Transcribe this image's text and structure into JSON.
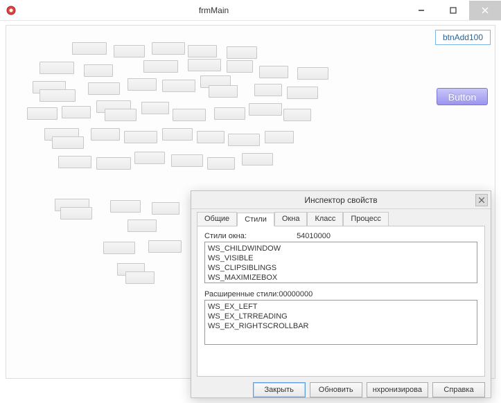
{
  "window": {
    "title": "frmMain"
  },
  "main": {
    "btnAdd100": "btnAdd100",
    "bigButton": "Button"
  },
  "inspector": {
    "title": "Инспектор свойств",
    "tabs": [
      "Общие",
      "Стили",
      "Окна",
      "Класс",
      "Процесс"
    ],
    "activeTab": 1,
    "styles": {
      "label": "Стили окна:",
      "value": "54010000",
      "list": [
        "WS_CHILDWINDOW",
        "WS_VISIBLE",
        "WS_CLIPSIBLINGS",
        "WS_MAXIMIZEBOX"
      ]
    },
    "exStyles": {
      "label": "Расширенные стили:",
      "value": "00000000",
      "list": [
        "WS_EX_LEFT",
        "WS_EX_LTRREADING",
        "WS_EX_RIGHTSCROLLBAR"
      ]
    },
    "buttons": {
      "close": "Закрыть",
      "refresh": "Обновить",
      "sync": "нхронизирова",
      "help": "Справка"
    }
  }
}
